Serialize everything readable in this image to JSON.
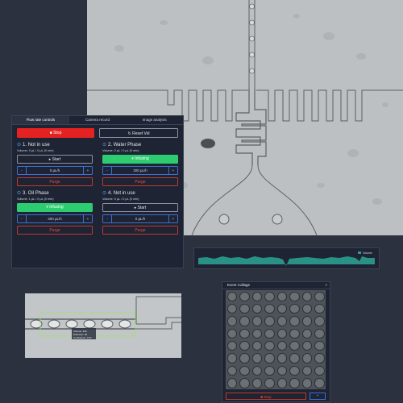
{
  "tabs": [
    {
      "label": "Flow rate controls",
      "active": true
    },
    {
      "label": "Camera record",
      "active": false
    },
    {
      "label": "Image analysis",
      "active": false
    }
  ],
  "top_buttons": {
    "stop_label": "Stop",
    "stop_icon": "stop-square-icon",
    "reset_label": "Reset Vol",
    "reset_icon": "refresh-icon"
  },
  "channels": [
    {
      "title": "1. Not in use",
      "volume": "Volume: 0 µL / 0 µL (0 min)",
      "state_label": "Start",
      "state": "start",
      "rate": "0 µL/h",
      "purge_label": "Purge"
    },
    {
      "title": "2. Water Phase",
      "volume": "Volume: 2 µL / 0 µL (0 min)",
      "state_label": "Infusing",
      "state": "infusing",
      "rate": "300 µL/h",
      "purge_label": "Purge"
    },
    {
      "title": "3. Oil Phase",
      "volume": "Volume: 1 µL / 0 µL (0 min)",
      "state_label": "Infusing",
      "state": "infusing",
      "rate": "300 µL/h",
      "purge_label": "Purge"
    },
    {
      "title": "4. Not in use",
      "volume": "Volume: 0 µL / 0 µL (0 min)",
      "state_label": "Start",
      "state": "start",
      "rate": "0 µL/h",
      "purge_label": "Purge"
    }
  ],
  "stepper": {
    "minus": "-",
    "plus": "+"
  },
  "trace": {
    "legend": "Volume",
    "color": "#2a9d8f"
  },
  "camera": {
    "annotation": [
      "Volume: 320",
      "Diameter: 90",
      "Confidence: 0.97"
    ]
  },
  "collage": {
    "title": "Event Collage",
    "close": "×",
    "stop_label": "Stop",
    "rows": 8,
    "cols": 8
  },
  "colors": {
    "stop": "#e52222",
    "infusing": "#2ecc71",
    "accent": "#3d6fd6",
    "panel": "#1e2433",
    "background": "#2c3140"
  }
}
